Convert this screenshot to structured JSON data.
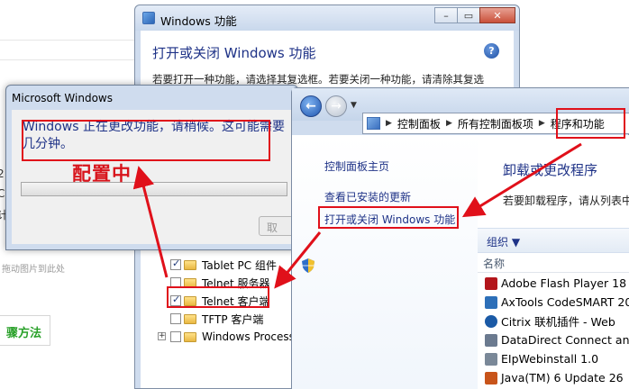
{
  "background": {
    "drag_hint": "拖动图片到此处",
    "method_button": "骤方法",
    "fragments": [
      "2",
      "C",
      "计"
    ]
  },
  "features_window": {
    "title": "Windows 功能",
    "heading": "打开或关闭 Windows 功能",
    "description": "若要打开一种功能，请选择其复选框。若要关闭一种功能，请清除其复选",
    "tree": [
      {
        "label": "Tablet PC 组件",
        "checked": true,
        "expandable": false
      },
      {
        "label": "Telnet 服务器",
        "checked": false,
        "expandable": false
      },
      {
        "label": "Telnet 客户端",
        "checked": true,
        "expandable": false
      },
      {
        "label": "TFTP 客户端",
        "checked": false,
        "expandable": false
      },
      {
        "label": "Windows Process",
        "checked": false,
        "expandable": true
      }
    ]
  },
  "progress_dialog": {
    "title": "Microsoft Windows",
    "message": "Windows 正在更改功能，请稍候。这可能需要几分钟。",
    "button_label": "取"
  },
  "control_panel": {
    "breadcrumbs": [
      "控制面板",
      "所有控制面板项",
      "程序和功能"
    ],
    "left_links": [
      "控制面板主页",
      "查看已安装的更新",
      "打开或关闭 Windows 功能"
    ],
    "heading": "卸载或更改程序",
    "subtext": "若要卸载程序，请从列表中",
    "organize_label": "组织 ▼",
    "column_name": "名称",
    "programs": [
      {
        "name": "Adobe Flash Player 18 A",
        "icon_color": "#b3151b"
      },
      {
        "name": "AxTools CodeSMART 20",
        "icon_color": "#2d6fb8"
      },
      {
        "name": "Citrix 联机插件 - Web",
        "icon_color": "#1b5aa6"
      },
      {
        "name": "DataDirect Connect and",
        "icon_color": "#6b7a8f"
      },
      {
        "name": "EIpWebinstall 1.0",
        "icon_color": "#7a8898"
      },
      {
        "name": "Java(TM) 6 Update 26",
        "icon_color": "#c8541a"
      }
    ]
  },
  "annotation": {
    "label": "配置中",
    "color": "#e0101a"
  }
}
